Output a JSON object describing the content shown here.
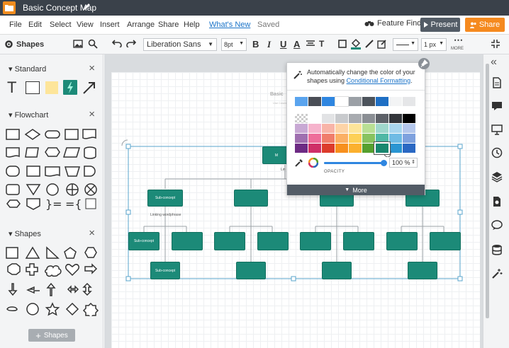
{
  "title_bar": {
    "doc_title": "Basic Concept Map"
  },
  "menu": {
    "items": [
      "File",
      "Edit",
      "Select",
      "View",
      "Insert",
      "Arrange",
      "Share",
      "Help"
    ],
    "whats_new": "What's New",
    "status": "Saved",
    "feature_find": "Feature Find",
    "present": "Present",
    "share": "Share"
  },
  "toolbar": {
    "shapes_label": "Shapes",
    "font": "Liberation Sans",
    "font_size": "8pt",
    "line_width": "1 px",
    "more": "MORE",
    "bold": "B",
    "italic": "I",
    "underline": "U",
    "font_color": "A",
    "text_options": "T"
  },
  "library": {
    "sections": [
      {
        "name": "Standard"
      },
      {
        "name": "Flowchart"
      },
      {
        "name": "Shapes"
      }
    ],
    "add_shapes": "Shapes"
  },
  "color_popup": {
    "tip_line1": "Automatically change the color of your",
    "tip_line2": "shapes using",
    "tip_link": "Conditional Formatting",
    "tip_end": ".",
    "opacity_label": "OPACITY",
    "opacity_value": "100 %",
    "opacity_fraction": 1.0,
    "more": "More",
    "selected_color": "#19876f",
    "palette_row1": [
      "#5aa4ee",
      "#4a4e56",
      "#2f86e0",
      "#ffffff",
      "#9ba0a6",
      "#4d545c",
      "#1f6fc4",
      "#f3f4f5",
      "#e5e6e8"
    ],
    "palette": [
      [
        "#ffffff",
        "#ffffff",
        "#e2e3e5",
        "#c8cacd",
        "#a8abb0",
        "#8a8e94",
        "#5d6168",
        "#33363b",
        "#000000"
      ],
      [
        "#c8a9d4",
        "#f6b3cc",
        "#f8b4a8",
        "#fdd4a7",
        "#fde59a",
        "#b9df94",
        "#9fd7cc",
        "#a9d6ee",
        "#b4c7ec"
      ],
      [
        "#9f6fb0",
        "#ee6d9a",
        "#f07d6b",
        "#fbb064",
        "#fdd057",
        "#88c35f",
        "#4fb8a5",
        "#6fbbe4",
        "#7ea1de"
      ],
      [
        "#6d2b84",
        "#cf2f67",
        "#dc3b2b",
        "#f7901e",
        "#fbb02e",
        "#55a02e",
        "#19876f",
        "#2a95d2",
        "#2a68c3"
      ]
    ]
  },
  "diagram": {
    "page_title": "Basic",
    "page_subtitle": "Use Cases",
    "linking_label": "Linking wordphrase",
    "sub_concept": "Sub-concept",
    "main_concept": "M",
    "link_abbrev": "Lin"
  }
}
